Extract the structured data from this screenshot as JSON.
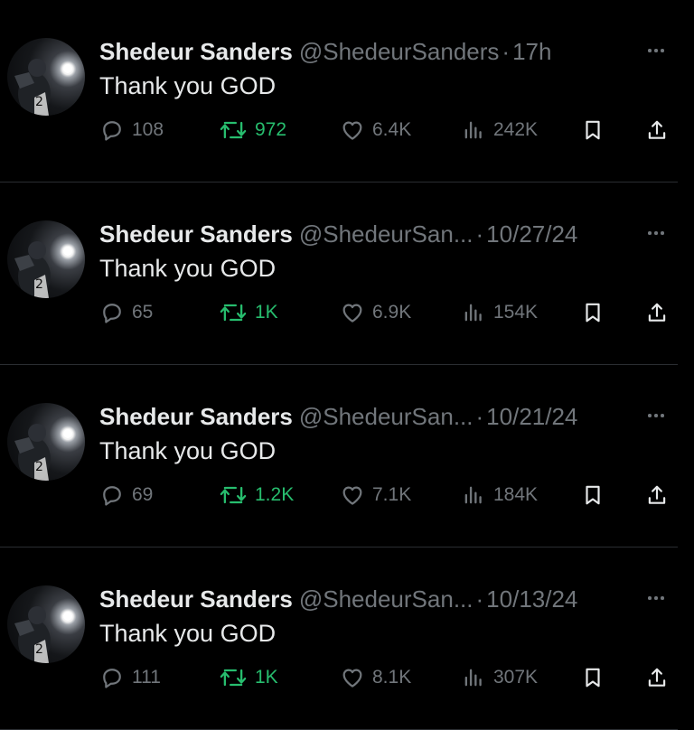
{
  "colors": {
    "background": "#000000",
    "primary_text": "#e7e9ea",
    "secondary_text": "#71767b",
    "retweet_accent": "#27bd6e",
    "divider": "#2a2d31"
  },
  "tweets": [
    {
      "name": "Shedeur Sanders",
      "handle": "@ShedeurSanders",
      "separator": "·",
      "time": "17h",
      "text": "Thank you GOD",
      "replies": "108",
      "retweets": "972",
      "likes": "6.4K",
      "views": "242K"
    },
    {
      "name": "Shedeur Sanders",
      "handle": "@ShedeurSan...",
      "separator": "·",
      "time": "10/27/24",
      "text": "Thank you GOD",
      "replies": "65",
      "retweets": "1K",
      "likes": "6.9K",
      "views": "154K"
    },
    {
      "name": "Shedeur Sanders",
      "handle": "@ShedeurSan...",
      "separator": "·",
      "time": "10/21/24",
      "text": "Thank you GOD",
      "replies": "69",
      "retweets": "1.2K",
      "likes": "7.1K",
      "views": "184K"
    },
    {
      "name": "Shedeur Sanders",
      "handle": "@ShedeurSan...",
      "separator": "·",
      "time": "10/13/24",
      "text": "Thank you GOD",
      "replies": "111",
      "retweets": "1K",
      "likes": "8.1K",
      "views": "307K"
    }
  ],
  "icons": {
    "more": "more-horizontal-icon",
    "reply": "reply-bubble-icon",
    "retweet": "retweet-icon",
    "like": "heart-icon",
    "views": "views-bar-chart-icon",
    "bookmark": "bookmark-icon",
    "share": "share-upload-icon"
  }
}
